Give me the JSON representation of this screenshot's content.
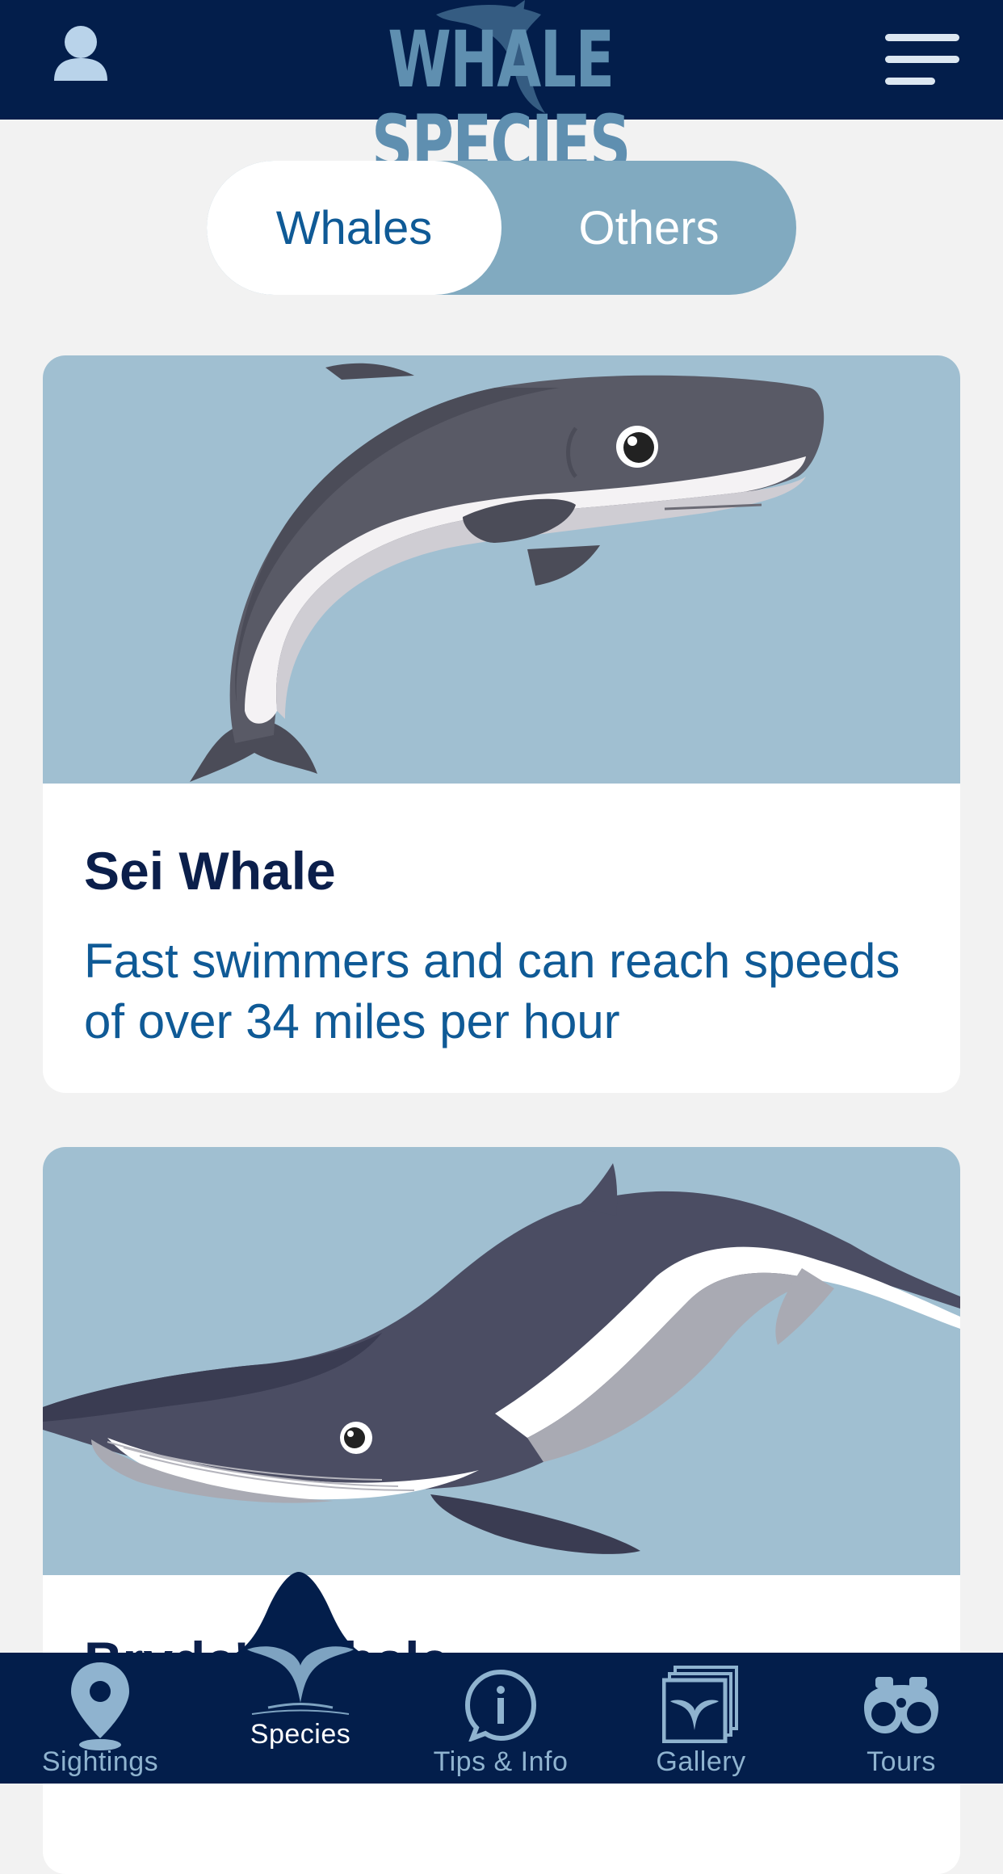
{
  "header": {
    "title": "WHALE SPECIES",
    "profile_icon": "user-icon",
    "menu_icon": "hamburger-menu-icon",
    "background": "#031e4b"
  },
  "segmented": {
    "active": "Whales",
    "options": [
      "Whales",
      "Others"
    ]
  },
  "species": [
    {
      "name": "Sei Whale",
      "description": "Fast swimmers and can reach speeds of over 34 miles per hour"
    },
    {
      "name": "Bryde's Whale",
      "description": ""
    }
  ],
  "nav": {
    "active": "Species",
    "items": [
      {
        "label": "Sightings",
        "icon": "map-pin-icon"
      },
      {
        "label": "Species",
        "icon": "whale-tail-icon"
      },
      {
        "label": "Tips & Info",
        "icon": "info-icon"
      },
      {
        "label": "Gallery",
        "icon": "gallery-icon"
      },
      {
        "label": "Tours",
        "icon": "binoculars-icon"
      }
    ]
  },
  "colors": {
    "navy": "#031e4b",
    "accent_blue": "#0f5a96",
    "light_blue": "#81aac0",
    "card_image_bg": "#a0bfd1"
  }
}
